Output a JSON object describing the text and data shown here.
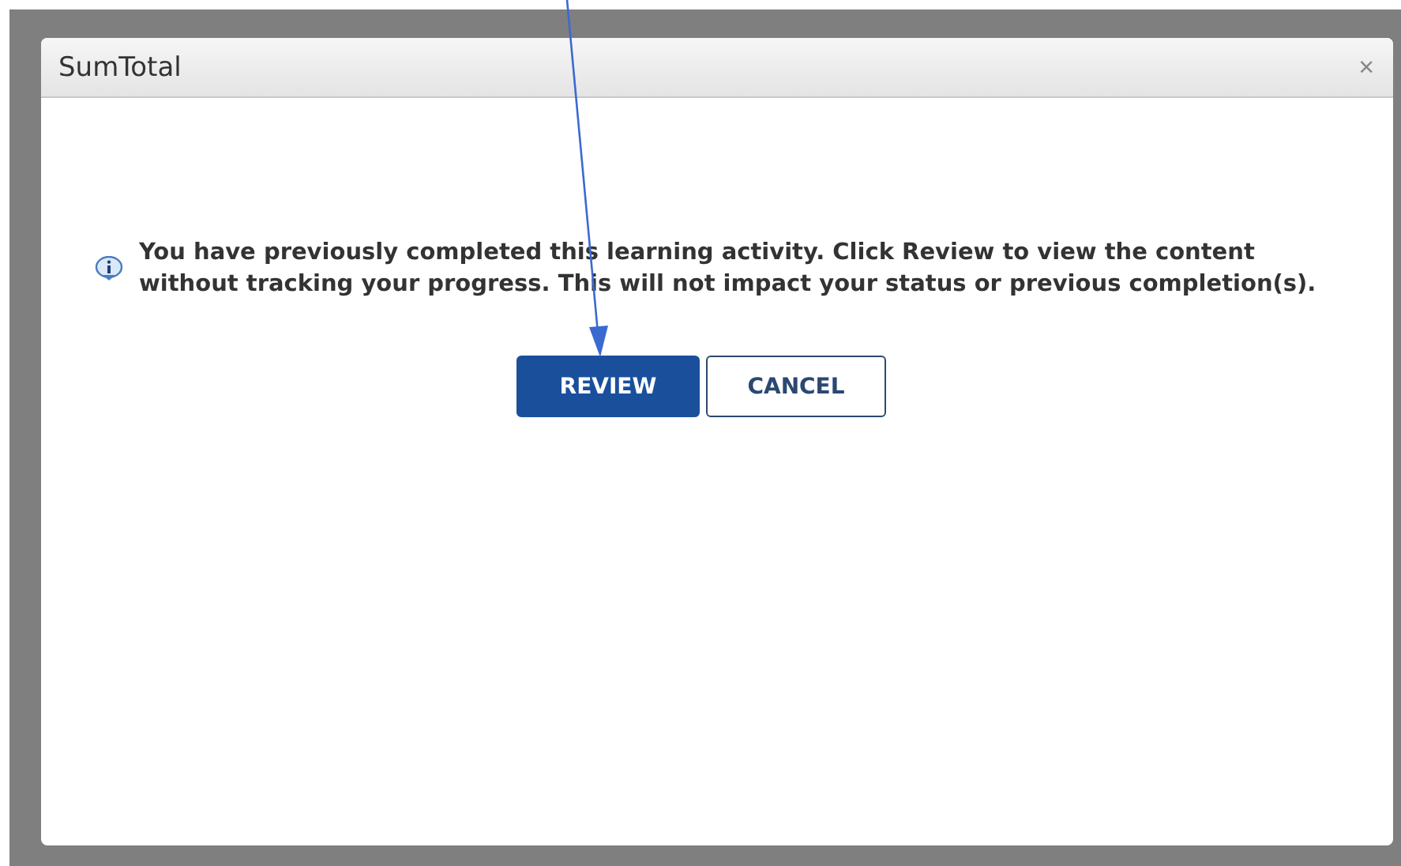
{
  "dialog": {
    "title": "SumTotal",
    "close": "×",
    "message": "You have previously completed this learning activity. Click Review to view the content without tracking your progress. This will not impact your status or previous completion(s).",
    "buttons": [
      {
        "label": "REVIEW",
        "kind": "primary"
      },
      {
        "label": "CANCEL",
        "kind": "secondary"
      }
    ]
  }
}
